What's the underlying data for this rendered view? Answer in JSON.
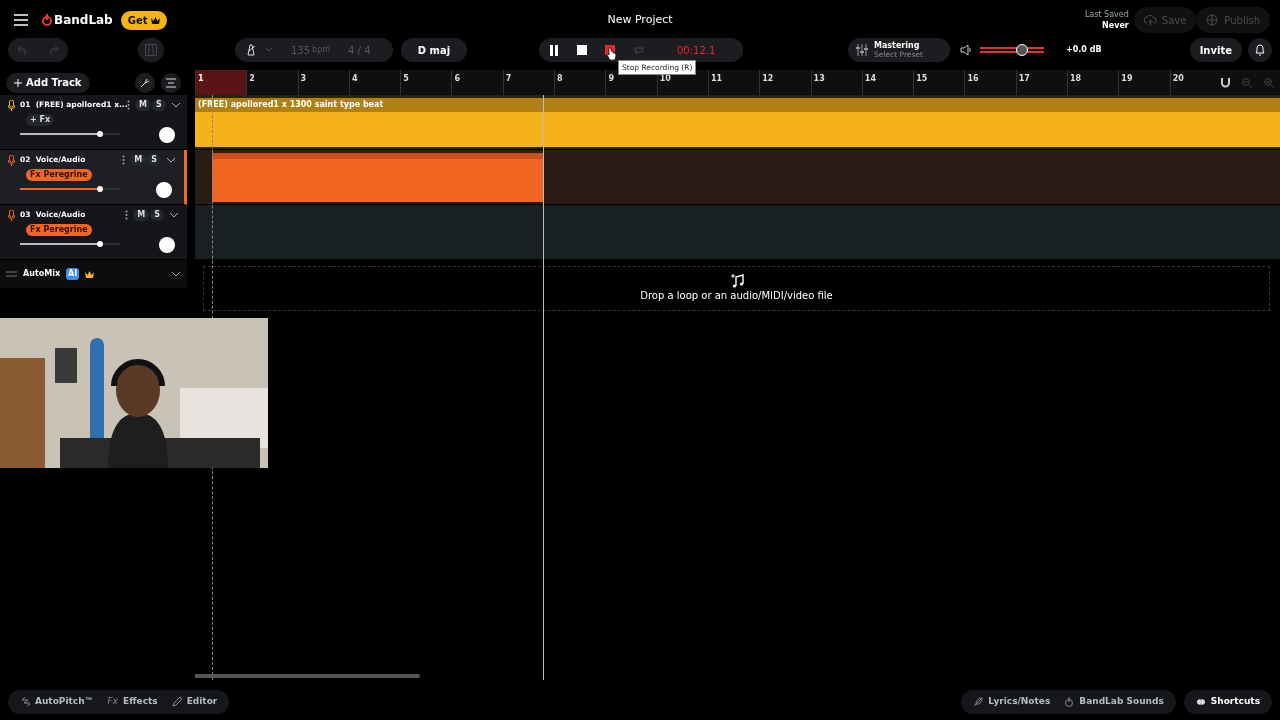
{
  "app": {
    "logo": "BandLab",
    "get_button": "Get"
  },
  "project_title": "New Project",
  "save_status": {
    "label": "Last Saved",
    "value": "Never"
  },
  "header_buttons": [
    {
      "kind": "save",
      "label": "Save",
      "disabled": true
    },
    {
      "kind": "publish",
      "label": "Publish",
      "disabled": true
    }
  ],
  "tempo": {
    "bpm": "135",
    "unit": "bpm",
    "signature": "4 / 4",
    "disabled": true
  },
  "key": "D maj",
  "transport": {
    "playing": true,
    "recording": true,
    "loop": false,
    "time": "00:12.1"
  },
  "tooltip": "Stop Recording (R)",
  "mastering": {
    "title": "Mastering",
    "preset": "Select Preset"
  },
  "master_volume": {
    "level": 0.65,
    "reading": "+0.0 dB"
  },
  "invite": "Invite",
  "add_track": "Add Track",
  "ruler": {
    "bars": [
      "1",
      "2",
      "3",
      "4",
      "5",
      "6",
      "7",
      "8",
      "9",
      "10",
      "11",
      "12",
      "13",
      "14",
      "15",
      "16",
      "17",
      "18",
      "19",
      "20"
    ]
  },
  "tracks": [
    {
      "number": "01",
      "name": "(FREE) apollored1 x...",
      "fx": {
        "kind": "add",
        "label": "+ Fx"
      },
      "color": "#f5b21a",
      "selected": false,
      "level": 0.8,
      "mute": "M",
      "solo": "S",
      "clip": {
        "kind": "audio",
        "title": "(FREE) apollored1 x 1300 saint type beat"
      }
    },
    {
      "number": "02",
      "name": "Voice/Audio",
      "fx": {
        "kind": "preset",
        "label": "Fx Peregrine"
      },
      "color": "#f26522",
      "selected": true,
      "level": 0.8,
      "mute": "M",
      "solo": "S",
      "clip": {
        "kind": "recording"
      }
    },
    {
      "number": "03",
      "name": "Voice/Audio",
      "fx": {
        "kind": "preset",
        "label": "Fx Peregrine"
      },
      "color": "#f26522",
      "selected": false,
      "level": 0.8,
      "mute": "M",
      "solo": "S"
    }
  ],
  "automix": {
    "label": "AutoMix",
    "badge": "AI"
  },
  "drop_zone": "Drop a loop or an audio/MIDI/video file",
  "bottom_left": [
    {
      "kind": "autopitch",
      "label": "AutoPitch™"
    },
    {
      "kind": "effects",
      "icon_text": "Fx",
      "label": "Effects"
    },
    {
      "kind": "editor",
      "label": "Editor"
    }
  ],
  "bottom_right": [
    {
      "kind": "lyrics",
      "label": "Lyrics/Notes"
    },
    {
      "kind": "sounds",
      "label": "BandLab Sounds"
    }
  ],
  "shortcuts": "Shortcuts"
}
